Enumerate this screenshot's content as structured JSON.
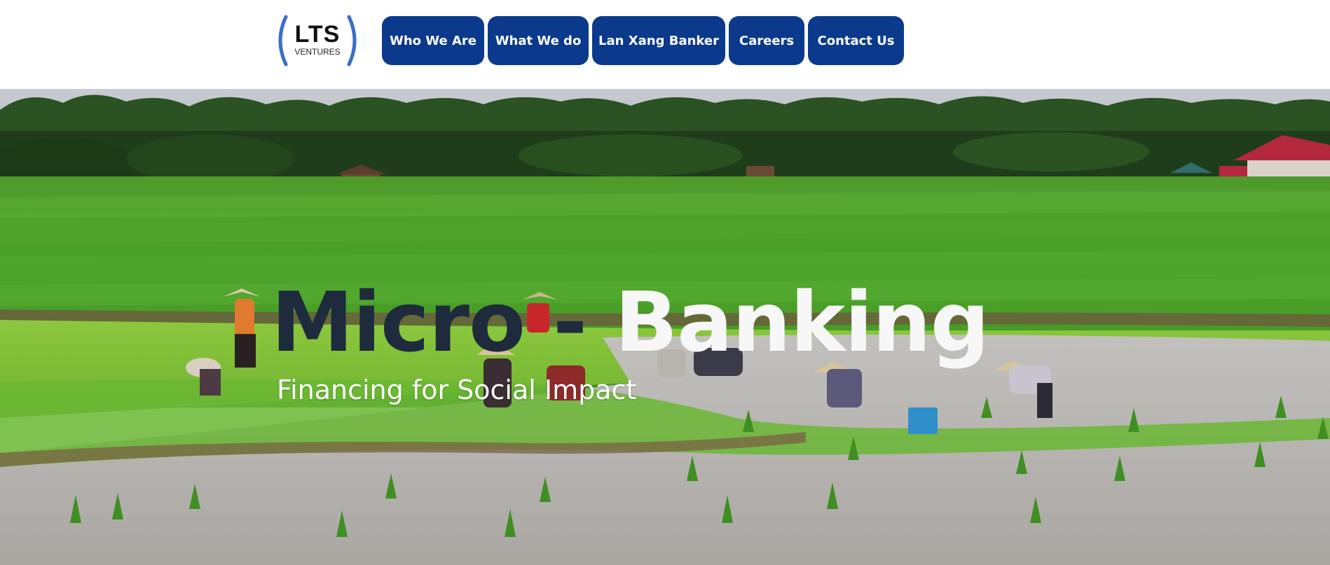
{
  "logo": {
    "main": "LTS",
    "sub": "VENTURES",
    "bracket_color": "#3a6fc8"
  },
  "nav": {
    "items": [
      {
        "label": "Who We Are"
      },
      {
        "label": "What We do"
      },
      {
        "label": "Lan Xang Banker"
      },
      {
        "label": "Careers"
      },
      {
        "label": "Contact Us"
      }
    ],
    "button_color": "#0b3a8c"
  },
  "hero": {
    "title_part1": "Micro",
    "title_sep": " - ",
    "title_part2": "Banking",
    "subtitle": "Financing for Social Impact",
    "image": "rice-field-farmers-photo",
    "title_dark_color": "#1e2b3c",
    "title_light_color": "#f7f7f7"
  }
}
